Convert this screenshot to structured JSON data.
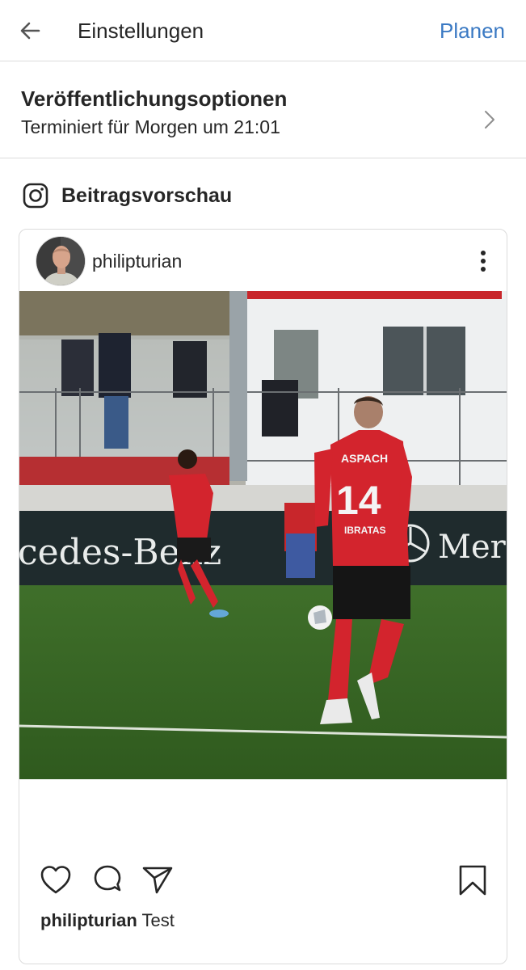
{
  "header": {
    "title": "Einstellungen",
    "action_label": "Planen",
    "accent_color": "#3a79c3",
    "back_icon": "arrow-left-icon"
  },
  "publishing": {
    "title": "Veröffentlichungsoptionen",
    "subtitle": "Terminiert für Morgen um 21:01",
    "chevron_icon": "chevron-right-icon"
  },
  "preview": {
    "title": "Beitragsvorschau",
    "icon": "instagram-icon"
  },
  "post": {
    "username": "philipturian",
    "more_icon": "more-vertical-icon",
    "photo": {
      "banner_text": "cedes-Benz",
      "banner_text_right": "Merc",
      "player_name": "ASPACH",
      "player_number": "14",
      "player_sponsor": "IBRATAS"
    },
    "actions": [
      "heart-icon",
      "comment-icon",
      "send-icon",
      "bookmark-icon"
    ],
    "caption_user": "philipturian",
    "caption_text": "Test"
  }
}
